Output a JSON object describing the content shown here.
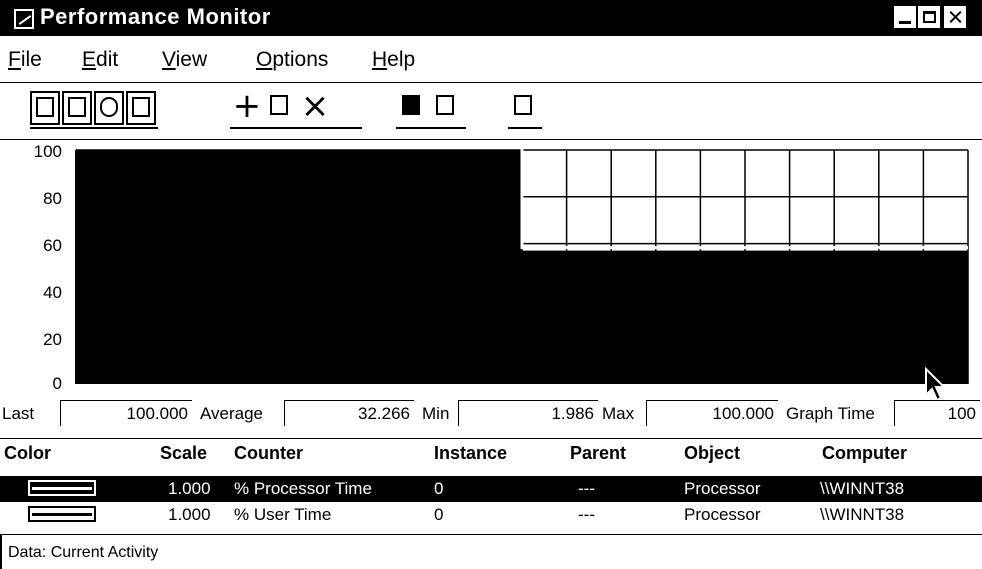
{
  "window": {
    "title": "Performance Monitor"
  },
  "menu": {
    "items": [
      {
        "mnemonic": "F",
        "rest": "ile"
      },
      {
        "mnemonic": "E",
        "rest": "dit"
      },
      {
        "mnemonic": "V",
        "rest": "iew"
      },
      {
        "mnemonic": "O",
        "rest": "ptions"
      },
      {
        "mnemonic": "H",
        "rest": "elp"
      }
    ]
  },
  "toolbar": {
    "icons": [
      "chart-view-icon",
      "alert-view-icon",
      "log-view-icon",
      "report-view-icon",
      "add-counter-icon",
      "edit-counter-icon",
      "delete-counter-icon",
      "update-now-icon",
      "bookmark-icon",
      "options-icon"
    ],
    "add_symbol": "+",
    "delete_symbol": "×"
  },
  "chart_data": {
    "type": "area",
    "ylim": [
      0,
      100
    ],
    "yticks": [
      "100",
      "80",
      "60",
      "40",
      "20",
      "0"
    ],
    "x": [
      0,
      0.5,
      0.5,
      1
    ],
    "series": [
      {
        "values": [
          100,
          100,
          57,
          57
        ]
      }
    ],
    "grid": true
  },
  "stats": {
    "last_label": "Last",
    "last_value": "100.000",
    "average_label": "Average",
    "average_value": "32.266",
    "min_label": "Min",
    "min_value": "1.986",
    "max_label": "Max",
    "max_value": "100.000",
    "graph_time_label": "Graph Time",
    "graph_time_value": "100"
  },
  "legend": {
    "headers": {
      "color": "Color",
      "scale": "Scale",
      "counter": "Counter",
      "instance": "Instance",
      "parent": "Parent",
      "object": "Object",
      "computer": "Computer"
    },
    "rows": [
      {
        "scale": "1.000",
        "counter": "% Processor Time",
        "instance": "0",
        "parent": "---",
        "object": "Processor",
        "computer": "\\\\WINNT38",
        "selected": true
      },
      {
        "scale": "1.000",
        "counter": "% User Time",
        "instance": "0",
        "parent": "---",
        "object": "Processor",
        "computer": "\\\\WINNT38",
        "selected": false
      }
    ]
  },
  "status": {
    "text": "Data: Current Activity"
  }
}
